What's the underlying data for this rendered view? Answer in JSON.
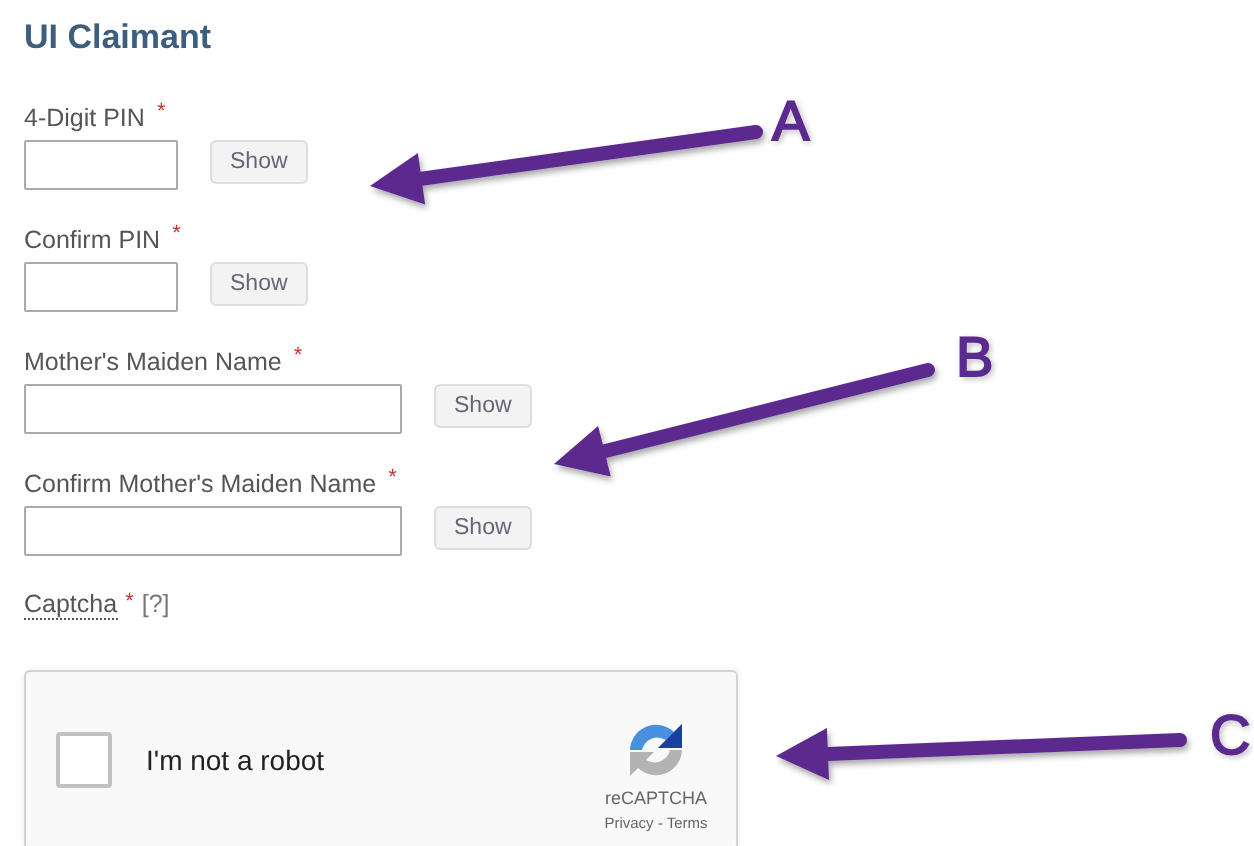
{
  "title": "UI Claimant",
  "fields": [
    {
      "label": "4-Digit PIN",
      "marker": "*",
      "kind": "short",
      "button": "Show"
    },
    {
      "label": "Confirm PIN",
      "marker": "*",
      "kind": "short",
      "button": "Show"
    },
    {
      "label": "Mother's Maiden Name",
      "marker": "*",
      "kind": "long",
      "button": "Show"
    },
    {
      "label": "Confirm Mother's Maiden Name",
      "marker": "*",
      "kind": "long",
      "button": "Show"
    }
  ],
  "captcha": {
    "label": "Captcha",
    "marker": "*",
    "help": "[?]",
    "checkbox_label": "I'm not a robot",
    "checked": false,
    "brand": "reCAPTCHA",
    "links": "Privacy - Terms"
  },
  "annotations": [
    {
      "label": "A"
    },
    {
      "label": "B"
    },
    {
      "label": "C"
    }
  ]
}
